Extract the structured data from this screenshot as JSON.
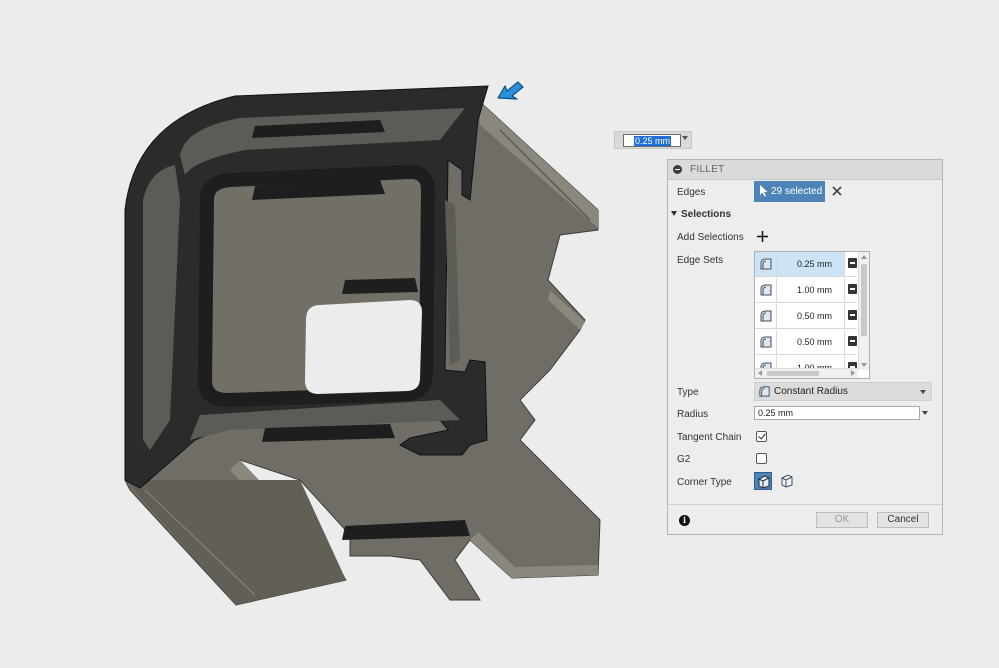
{
  "float_input": {
    "value": "0.25 mm"
  },
  "dialog": {
    "title": "FILLET",
    "edges": {
      "label": "Edges",
      "button_label": "29 selected"
    },
    "selections": {
      "title": "Selections",
      "add_label": "Add Selections",
      "edge_sets_label": "Edge Sets",
      "edge_sets": [
        {
          "value": "0.25 mm",
          "selected": true
        },
        {
          "value": "1.00 mm",
          "selected": false
        },
        {
          "value": "0.50 mm",
          "selected": false
        },
        {
          "value": "0.50 mm",
          "selected": false
        },
        {
          "value": "1.00 mm",
          "selected": false
        }
      ]
    },
    "type": {
      "label": "Type",
      "value": "Constant Radius"
    },
    "radius": {
      "label": "Radius",
      "value": "0.25 mm"
    },
    "tangent_chain": {
      "label": "Tangent Chain",
      "checked": true
    },
    "g2": {
      "label": "G2",
      "checked": false
    },
    "corner_type": {
      "label": "Corner Type"
    },
    "ok_label": "OK",
    "cancel_label": "Cancel"
  },
  "colors": {
    "accent": "#4d84b8",
    "model_face": "#6f6d65",
    "model_dark": "#2a2a2a",
    "pointer_arrow": "#2a8fd6"
  }
}
